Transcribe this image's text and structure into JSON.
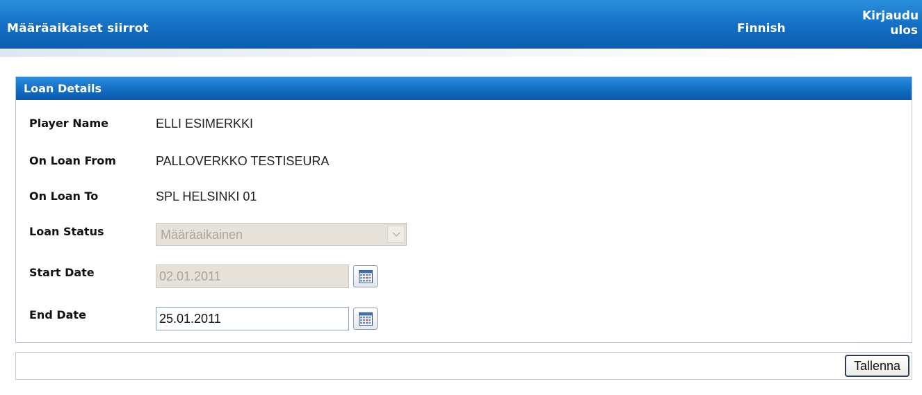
{
  "header": {
    "app_title": "Määräaikaiset siirrot",
    "language": "Finnish",
    "logout_line1": "Kirjaudu",
    "logout_line2": "ulos"
  },
  "panel": {
    "title": "Loan Details",
    "fields": {
      "player_name": {
        "label": "Player Name",
        "value": "ELLI  ESIMERKKI"
      },
      "on_loan_from": {
        "label": "On Loan From",
        "value": "PALLOVERKKO TESTISEURA"
      },
      "on_loan_to": {
        "label": "On Loan To",
        "value": "SPL HELSINKI 01"
      },
      "loan_status": {
        "label": "Loan Status",
        "value": "Määräaikainen",
        "disabled": true
      },
      "start_date": {
        "label": "Start Date",
        "value": "02.01.2011",
        "disabled": true
      },
      "end_date": {
        "label": "End Date",
        "value": "25.01.2011",
        "disabled": false
      }
    }
  },
  "actions": {
    "save_label": "Tallenna"
  },
  "icons": {
    "calendar": "calendar-icon",
    "dropdown": "chevron-down-icon"
  },
  "colors": {
    "header_blue": "#1673c8",
    "disabled_fill": "#e6e1d9",
    "disabled_text": "#aaa49b"
  }
}
